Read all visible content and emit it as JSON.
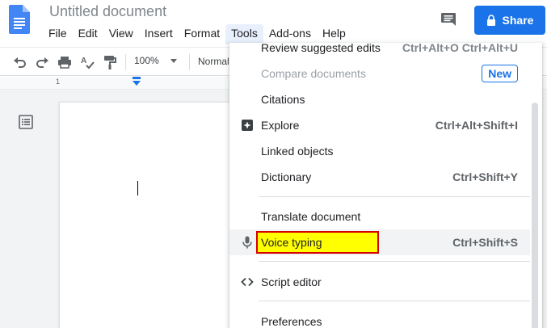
{
  "header": {
    "doc_title": "Untitled document",
    "menu": [
      {
        "label": "File"
      },
      {
        "label": "Edit"
      },
      {
        "label": "View"
      },
      {
        "label": "Insert"
      },
      {
        "label": "Format"
      },
      {
        "label": "Tools"
      },
      {
        "label": "Add-ons"
      },
      {
        "label": "Help"
      }
    ],
    "share_label": "Share"
  },
  "toolbar": {
    "zoom": "100%",
    "style": "Normal"
  },
  "ruler": {
    "marker_label": "1"
  },
  "tools_menu": {
    "items": [
      {
        "label": "Review suggested edits",
        "shortcut": "Ctrl+Alt+O Ctrl+Alt+U"
      },
      {
        "label": "Compare documents",
        "badge": "New"
      },
      {
        "label": "Citations"
      },
      {
        "label": "Explore",
        "shortcut": "Ctrl+Alt+Shift+I"
      },
      {
        "label": "Linked objects"
      },
      {
        "label": "Dictionary",
        "shortcut": "Ctrl+Shift+Y"
      },
      {
        "label": "Translate document"
      },
      {
        "label": "Voice typing",
        "shortcut": "Ctrl+Shift+S"
      },
      {
        "label": "Script editor"
      },
      {
        "label": "Preferences"
      }
    ]
  },
  "colors": {
    "accent": "#1a73e8",
    "highlight": "#ffff00",
    "highlight_border": "#d50000",
    "doc_icon": "#4285f4"
  },
  "icons": {
    "logo": "google-docs-icon",
    "comment": "comment-icon",
    "lock": "lock-icon",
    "undo": "undo-icon",
    "redo": "redo-icon",
    "print": "print-icon",
    "spellcheck": "spellcheck-icon",
    "paint_format": "paint-format-icon",
    "outline": "document-outline-icon",
    "explore": "explore-icon",
    "voice": "microphone-icon",
    "script": "code-icon"
  }
}
